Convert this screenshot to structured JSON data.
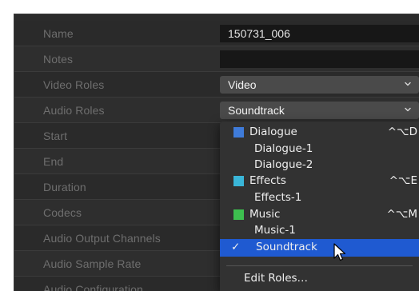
{
  "inspector": {
    "rows": [
      {
        "label": "Name",
        "value": "150731_006",
        "kind": "text"
      },
      {
        "label": "Notes",
        "value": "",
        "kind": "text"
      },
      {
        "label": "Video Roles",
        "value": "Video",
        "kind": "popup"
      },
      {
        "label": "Audio Roles",
        "value": "Soundtrack",
        "kind": "popup"
      },
      {
        "label": "Start",
        "kind": "none"
      },
      {
        "label": "End",
        "kind": "none"
      },
      {
        "label": "Duration",
        "kind": "none"
      },
      {
        "label": "Codecs",
        "kind": "none"
      },
      {
        "label": "Audio Output Channels",
        "kind": "none"
      },
      {
        "label": "Audio Sample Rate",
        "kind": "none"
      },
      {
        "label": "Audio Configuration",
        "kind": "none"
      }
    ]
  },
  "menu": {
    "items": [
      {
        "label": "Dialogue",
        "color": "#3f7bd9",
        "shortcut": "^⌥D",
        "level": 0
      },
      {
        "label": "Dialogue-1",
        "level": 1
      },
      {
        "label": "Dialogue-2",
        "level": 1
      },
      {
        "label": "Effects",
        "color": "#3ab6d8",
        "shortcut": "^⌥E",
        "level": 0
      },
      {
        "label": "Effects-1",
        "level": 1
      },
      {
        "label": "Music",
        "color": "#3dbf4f",
        "shortcut": "^⌥M",
        "level": 0
      },
      {
        "label": "Music-1",
        "level": 1
      },
      {
        "label": "Soundtrack",
        "level": 0,
        "checked": true,
        "selected": true
      }
    ],
    "checkmark": "✓",
    "edit_roles": "Edit Roles…"
  }
}
